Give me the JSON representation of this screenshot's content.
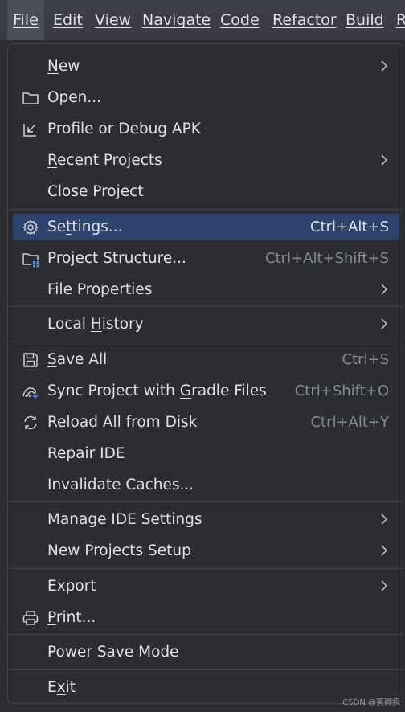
{
  "menubar": {
    "items": [
      {
        "label": "File",
        "active": true
      },
      {
        "label": "Edit"
      },
      {
        "label": "View"
      },
      {
        "label": "Navigate"
      },
      {
        "label": "Code"
      },
      {
        "label": "Refactor"
      },
      {
        "label": "Build"
      },
      {
        "label": "R"
      }
    ]
  },
  "menu": {
    "items": [
      {
        "id": "new",
        "pre": "",
        "u": "N",
        "post": "ew",
        "icon": "",
        "shortcut": "",
        "submenu": true
      },
      {
        "id": "open",
        "pre": "Open...",
        "u": "",
        "post": "",
        "icon": "folder-icon",
        "shortcut": "",
        "submenu": false
      },
      {
        "id": "profile",
        "pre": "Profile or Debug APK",
        "u": "",
        "post": "",
        "icon": "import-arrow-icon",
        "shortcut": "",
        "submenu": false
      },
      {
        "id": "recent",
        "pre": "",
        "u": "R",
        "post": "ecent Projects",
        "icon": "",
        "shortcut": "",
        "submenu": true
      },
      {
        "id": "close",
        "pre": "Close Project",
        "u": "",
        "post": "",
        "icon": "",
        "shortcut": "",
        "submenu": false
      },
      {
        "id": "settings",
        "pre": "Se",
        "u": "t",
        "post": "tings...",
        "icon": "gear-icon",
        "shortcut": "Ctrl+Alt+S",
        "submenu": false,
        "selected": true
      },
      {
        "id": "structure",
        "pre": "Project Structure...",
        "u": "",
        "post": "",
        "icon": "project-structure-icon",
        "shortcut": "Ctrl+Alt+Shift+S",
        "submenu": false
      },
      {
        "id": "fileprops",
        "pre": "File Properties",
        "u": "",
        "post": "",
        "icon": "",
        "shortcut": "",
        "submenu": true
      },
      {
        "id": "history",
        "pre": "Local ",
        "u": "H",
        "post": "istory",
        "icon": "",
        "shortcut": "",
        "submenu": true
      },
      {
        "id": "saveall",
        "pre": "",
        "u": "S",
        "post": "ave All",
        "icon": "save-icon",
        "shortcut": "Ctrl+S",
        "submenu": false
      },
      {
        "id": "sync",
        "pre": "Sync Project with ",
        "u": "G",
        "post": "radle Files",
        "icon": "gradle-sync-icon",
        "shortcut": "Ctrl+Shift+O",
        "submenu": false
      },
      {
        "id": "reload",
        "pre": "Reload All from Disk",
        "u": "",
        "post": "",
        "icon": "reload-icon",
        "shortcut": "Ctrl+Alt+Y",
        "submenu": false
      },
      {
        "id": "repair",
        "pre": "Repair IDE",
        "u": "",
        "post": "",
        "icon": "",
        "shortcut": "",
        "submenu": false
      },
      {
        "id": "invalidate",
        "pre": "Invalidate Caches...",
        "u": "",
        "post": "",
        "icon": "",
        "shortcut": "",
        "submenu": false
      },
      {
        "id": "manage",
        "pre": "Manage IDE Settings",
        "u": "",
        "post": "",
        "icon": "",
        "shortcut": "",
        "submenu": true
      },
      {
        "id": "newsetup",
        "pre": "New Projects Setup",
        "u": "",
        "post": "",
        "icon": "",
        "shortcut": "",
        "submenu": true
      },
      {
        "id": "export",
        "pre": "Export",
        "u": "",
        "post": "",
        "icon": "",
        "shortcut": "",
        "submenu": true
      },
      {
        "id": "print",
        "pre": "",
        "u": "P",
        "post": "rint...",
        "icon": "print-icon",
        "shortcut": "",
        "submenu": false
      },
      {
        "id": "powersave",
        "pre": "Power Save Mode",
        "u": "",
        "post": "",
        "icon": "",
        "shortcut": "",
        "submenu": false
      },
      {
        "id": "exit",
        "pre": "E",
        "u": "x",
        "post": "it",
        "icon": "",
        "shortcut": "",
        "submenu": false
      }
    ]
  },
  "watermark": "CSDN @笑卿疯",
  "colors": {
    "background": "#2b2d30",
    "selection": "#2e436e",
    "text": "#dfe1e5",
    "shortcut_text": "#868a91",
    "separator": "#43454a",
    "accent_blue": "#4a8df0"
  }
}
